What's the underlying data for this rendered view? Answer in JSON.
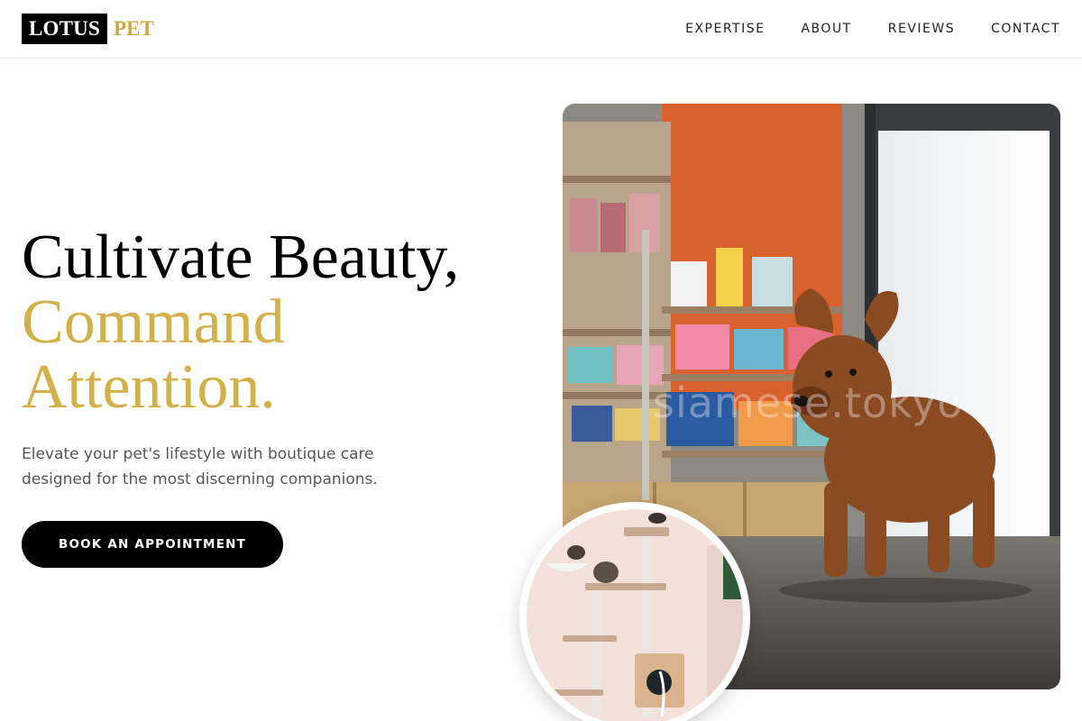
{
  "brand": {
    "name_primary": "LOTUS",
    "name_secondary": "PET",
    "colors": {
      "black": "#000000",
      "gold": "#d2b04a"
    }
  },
  "nav": {
    "items": [
      {
        "label": "EXPERTISE"
      },
      {
        "label": "ABOUT"
      },
      {
        "label": "REVIEWS"
      },
      {
        "label": "CONTACT"
      }
    ]
  },
  "hero": {
    "headline_line1": "Cultivate Beauty,",
    "headline_line2": "Command",
    "headline_line3": "Attention.",
    "subtext": "Elevate your pet's lifestyle with boutique care designed for the most discerning companions.",
    "cta_label": "BOOK AN APPOINTMENT"
  },
  "images": {
    "main_photo_watermark": "siamese.tokyo"
  }
}
